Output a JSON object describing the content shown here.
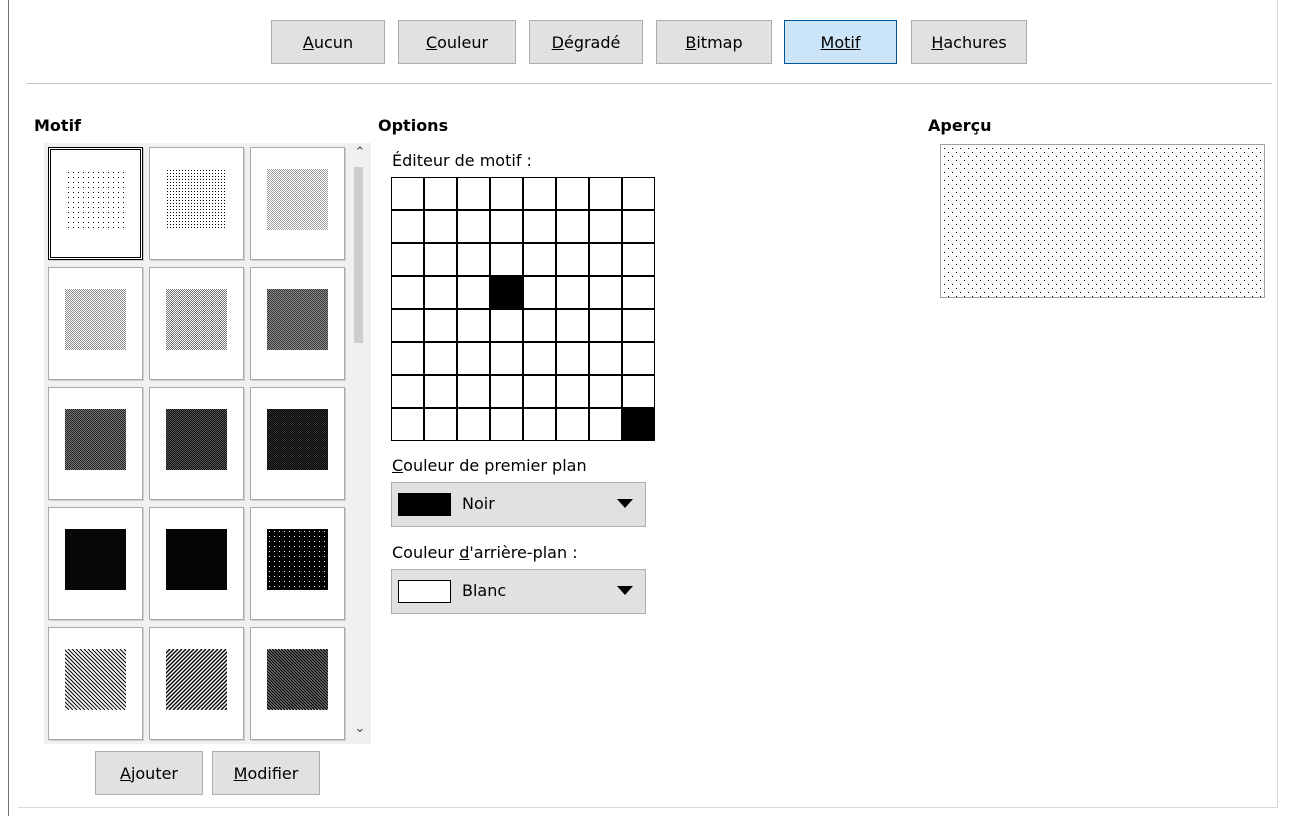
{
  "tabs": [
    {
      "label": "Aucun",
      "active": false
    },
    {
      "label": "Couleur",
      "active": false
    },
    {
      "label": "Dégradé",
      "active": false
    },
    {
      "label": "Bitmap",
      "active": false
    },
    {
      "label": "Motif",
      "active": true
    },
    {
      "label": "Hachures",
      "active": false
    }
  ],
  "motif": {
    "heading": "Motif",
    "patterns": [
      "sparse-dots-5",
      "dense-dots-10",
      "dense-dots-20",
      "dots-25",
      "dots-30",
      "dots-40",
      "dots-50",
      "dots-60",
      "dots-70",
      "dots-75",
      "dots-80",
      "dots-90",
      "diagonal-lines-light",
      "diagonal-lines-medium",
      "diagonal-lines-heavy"
    ],
    "selected_index": 0,
    "add_label": "Ajouter",
    "modify_label": "Modifier"
  },
  "options": {
    "heading": "Options",
    "editor_label": "Éditeur de motif :",
    "grid_filled": [
      [
        3,
        3
      ],
      [
        7,
        7
      ]
    ],
    "foreground_label": "Couleur de premier plan",
    "foreground_value": "Noir",
    "foreground_color": "#000000",
    "background_label": "Couleur d'arrière-plan :",
    "background_value": "Blanc",
    "background_color": "#ffffff"
  },
  "preview": {
    "heading": "Aperçu"
  }
}
